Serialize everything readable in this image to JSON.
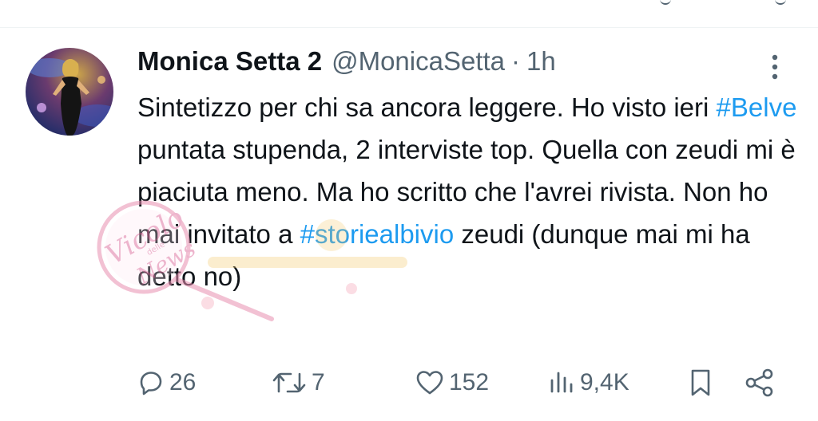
{
  "tweet": {
    "author_name": "Monica Setta 2",
    "author_handle": "@MonicaSetta",
    "separator": "·",
    "time": "1h",
    "text_parts": [
      "Sintetizzo per chi sa ancora leggere. Ho visto ieri ",
      "#Belve",
      " puntata stupenda, 2 interviste top. Quella con zeudi mi è piaciuta meno. Ma ho scritto che l'avrei rivista. Non ho mai invitato a ",
      "#storiealbivio",
      " zeudi (dunque mai mi ha detto no)"
    ]
  },
  "actions": {
    "replies": "26",
    "retweets": "7",
    "likes": "152",
    "views": "9,4K"
  },
  "icons": {
    "more": "more-vertical-icon",
    "reply": "reply-icon",
    "retweet": "retweet-icon",
    "like": "heart-icon",
    "views": "views-icon",
    "bookmark": "bookmark-icon",
    "share": "share-icon"
  },
  "watermark": {
    "text": "Vicolo delle News"
  },
  "colors": {
    "hashtag": "#1d9bf0",
    "secondary_text": "#536471",
    "primary_text": "#0f1419"
  }
}
